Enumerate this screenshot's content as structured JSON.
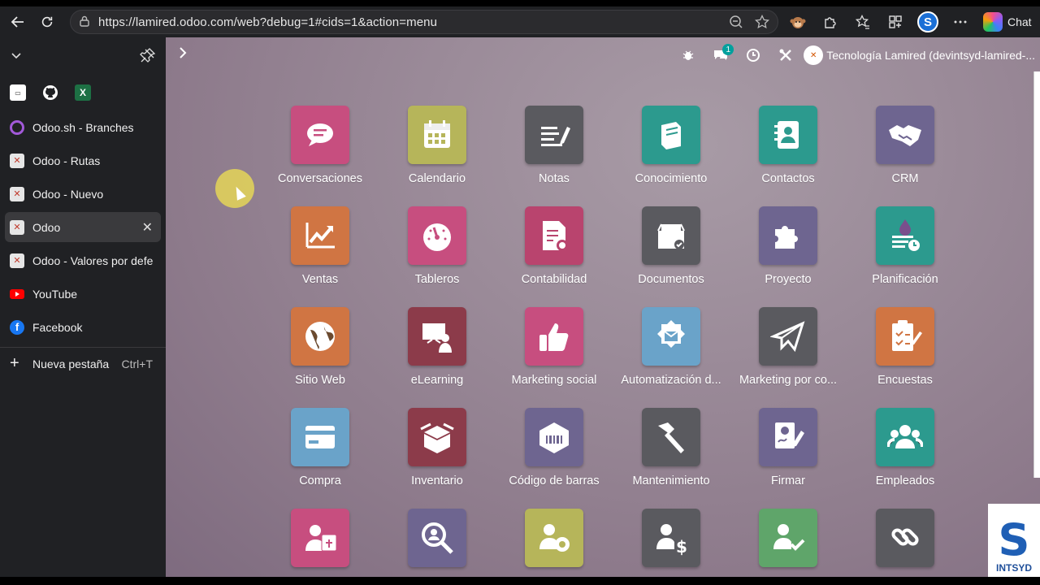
{
  "browser": {
    "url": "https://lamired.odoo.com/web?debug=1#cids=1&action=menu",
    "chat_label": "Chat",
    "profile_letter": "S"
  },
  "sidebar": {
    "pinned": [
      {
        "name": "pinned-tab-1",
        "icon": "site-icon",
        "color": "#ffffff"
      },
      {
        "name": "pinned-tab-github",
        "icon": "github-icon",
        "color": "#ffffff"
      },
      {
        "name": "pinned-tab-excel",
        "icon": "excel-icon",
        "color": "#1d7044"
      }
    ],
    "tabs": [
      {
        "label": "Odoo.sh - Branches",
        "icon": "odoo-sh-icon",
        "color": "#a259d9",
        "active": false
      },
      {
        "label": "Odoo - Rutas",
        "icon": "odoo-icon",
        "color": "#e6e6e6",
        "active": false
      },
      {
        "label": "Odoo - Nuevo",
        "icon": "odoo-icon",
        "color": "#e6e6e6",
        "active": false
      },
      {
        "label": "Odoo",
        "icon": "odoo-icon",
        "color": "#e6e6e6",
        "active": true
      },
      {
        "label": "Odoo - Valores por defe",
        "icon": "odoo-icon",
        "color": "#e6e6e6",
        "active": false
      },
      {
        "label": "YouTube",
        "icon": "youtube-icon",
        "color": "#ff0000",
        "active": false
      },
      {
        "label": "Facebook",
        "icon": "facebook-icon",
        "color": "#1877f2",
        "active": false
      }
    ],
    "new_tab_label": "Nueva pestaña",
    "new_tab_shortcut": "Ctrl+T"
  },
  "odoo": {
    "chat_badge": "1",
    "company": "Tecnología Lamired (devintsyd-lamired-...",
    "apps": [
      {
        "label": "Conversaciones",
        "icon": "chat-bubble-icon",
        "color": "#c74e7f"
      },
      {
        "label": "Calendario",
        "icon": "calendar-icon",
        "color": "#b6b55a"
      },
      {
        "label": "Notas",
        "icon": "notes-icon",
        "color": "#5a5a5f"
      },
      {
        "label": "Conocimiento",
        "icon": "book-icon",
        "color": "#2c9a8e"
      },
      {
        "label": "Contactos",
        "icon": "contacts-icon",
        "color": "#2c9a8e"
      },
      {
        "label": "CRM",
        "icon": "handshake-icon",
        "color": "#6e6590"
      },
      {
        "label": "Ventas",
        "icon": "chart-up-icon",
        "color": "#d07543"
      },
      {
        "label": "Tableros",
        "icon": "gauge-icon",
        "color": "#c74e7f"
      },
      {
        "label": "Contabilidad",
        "icon": "invoice-gear-icon",
        "color": "#b9446e"
      },
      {
        "label": "Documentos",
        "icon": "document-box-icon",
        "color": "#5a5a5f"
      },
      {
        "label": "Proyecto",
        "icon": "puzzle-icon",
        "color": "#6e6590"
      },
      {
        "label": "Planificación",
        "icon": "planning-icon",
        "color": "#2c9a8e"
      },
      {
        "label": "Sitio Web",
        "icon": "globe-icon",
        "color": "#d07543"
      },
      {
        "label": "eLearning",
        "icon": "elearning-icon",
        "color": "#8c3b4a"
      },
      {
        "label": "Marketing social",
        "icon": "thumbs-up-icon",
        "color": "#c74e7f"
      },
      {
        "label": "Automatización d...",
        "icon": "gear-envelope-icon",
        "color": "#6aa3c9"
      },
      {
        "label": "Marketing por co...",
        "icon": "paper-plane-icon",
        "color": "#5a5a5f"
      },
      {
        "label": "Encuestas",
        "icon": "survey-icon",
        "color": "#d07543"
      },
      {
        "label": "Compra",
        "icon": "credit-card-icon",
        "color": "#6aa3c9"
      },
      {
        "label": "Inventario",
        "icon": "open-box-icon",
        "color": "#8c3b4a"
      },
      {
        "label": "Código de barras",
        "icon": "barcode-box-icon",
        "color": "#6e6590"
      },
      {
        "label": "Mantenimiento",
        "icon": "hammer-icon",
        "color": "#5a5a5f"
      },
      {
        "label": "Firmar",
        "icon": "sign-icon",
        "color": "#6e6590"
      },
      {
        "label": "Empleados",
        "icon": "team-icon",
        "color": "#2c9a8e"
      },
      {
        "label": "",
        "icon": "time-off-icon",
        "color": "#c74e7f"
      },
      {
        "label": "",
        "icon": "search-person-icon",
        "color": "#6e6590"
      },
      {
        "label": "",
        "icon": "person-gear-icon",
        "color": "#b6b55a"
      },
      {
        "label": "",
        "icon": "person-dollar-icon",
        "color": "#5a5a5f"
      },
      {
        "label": "",
        "icon": "person-check-icon",
        "color": "#5fa56a"
      },
      {
        "label": "",
        "icon": "link-icon",
        "color": "#5a5a5f"
      }
    ]
  },
  "watermark": {
    "letter": "S",
    "text": "INTSYD"
  }
}
